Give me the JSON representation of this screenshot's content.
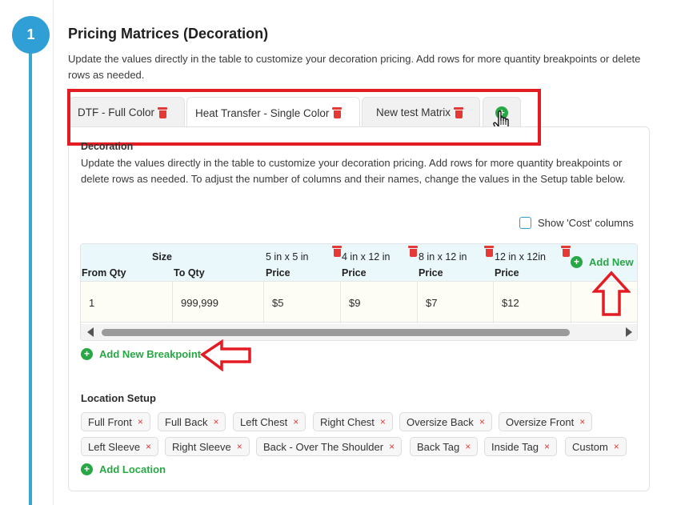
{
  "step": {
    "number": "1"
  },
  "header": {
    "title": "Pricing Matrices (Decoration)",
    "description": "Update the values directly in the table to customize your decoration pricing. Add rows for more quantity breakpoints or delete rows as needed."
  },
  "tabs": [
    {
      "label": "DTF - Full Color",
      "active": false
    },
    {
      "label": "Heat Transfer - Single Color",
      "active": true
    },
    {
      "label": "New test Matrix",
      "active": false
    }
  ],
  "add_tab": {
    "glyph": "+"
  },
  "decoration": {
    "label": "Decoration",
    "description": "Update the values directly in the table to customize your decoration pricing. Add rows for more quantity breakpoints or delete rows as needed. To adjust the number of columns and their names, change the values in the Setup table below.",
    "show_cost_label": "Show 'Cost' columns"
  },
  "table": {
    "size_header": "Size",
    "from_qty_header": "From Qty",
    "to_qty_header": "To Qty",
    "columns": [
      {
        "size": "5 in x 5 in",
        "sub": "Price"
      },
      {
        "size": "4 in x 12 in",
        "sub": "Price"
      },
      {
        "size": "8 in x 12 in",
        "sub": "Price"
      },
      {
        "size": "12 in x 12in",
        "sub": "Price"
      }
    ],
    "add_new_label": "Add New",
    "rows": [
      {
        "from": "1",
        "to": "999,999",
        "prices": [
          "$5",
          "$9",
          "$7",
          "$12"
        ]
      }
    ]
  },
  "add_breakpoint_label": "Add New Breakpoint",
  "location": {
    "label": "Location Setup",
    "chips": [
      "Full Front",
      "Full Back",
      "Left Chest",
      "Right Chest",
      "Oversize Back",
      "Oversize Front",
      "Left Sleeve",
      "Right Sleeve",
      "Back - Over The Shoulder",
      "Back Tag",
      "Inside Tag",
      "Custom"
    ],
    "remove_glyph": "×",
    "add_label": "Add Location"
  },
  "colors": {
    "accent_blue": "#2f9fd6",
    "add_green": "#27a844",
    "delete_red": "#e53935",
    "highlight_red": "#e31b23"
  },
  "icons": {
    "tab_delete": "trash-icon",
    "add": "plus-circle-icon",
    "cursor": "hand-pointer-icon",
    "remove_chip": "close-icon",
    "scroll_left": "caret-left-icon",
    "scroll_right": "caret-right-icon"
  }
}
